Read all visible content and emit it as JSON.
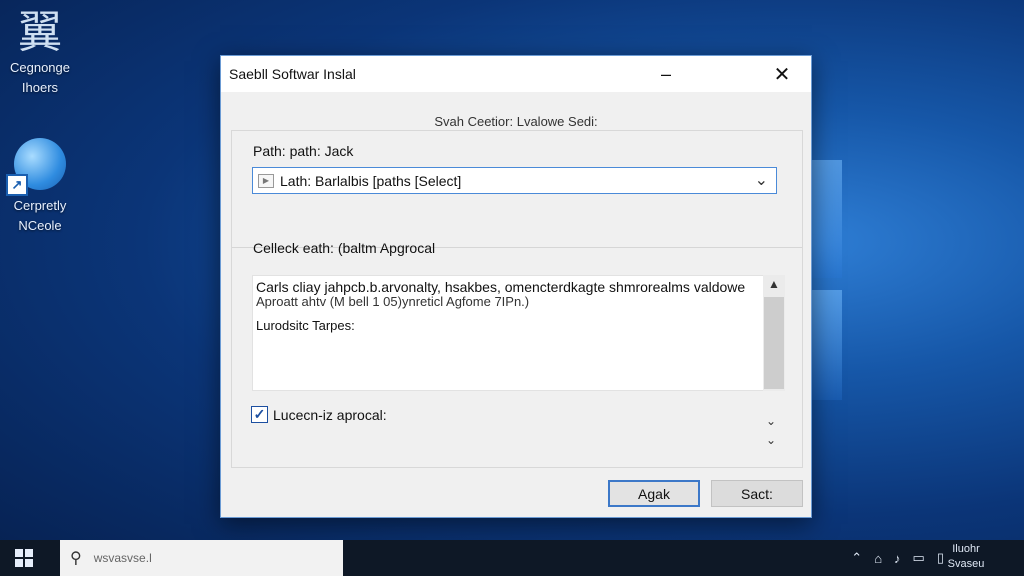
{
  "desktop": {
    "icons": [
      {
        "glyph": "翼",
        "label_line1": "Cegnonge",
        "label_line2": "Ihoers",
        "icon": "app-glyph-icon"
      },
      {
        "label_line1": "Cerpretly",
        "label_line2": "NCeole",
        "icon": "globe-installer-icon"
      }
    ]
  },
  "dialog": {
    "title": "Saebll Softwar Inslal",
    "minimize_glyph": "–",
    "close_glyph": "✕",
    "header": "Svah Ceetior: Lvalowe Sedi:",
    "path_label": "Path: path: Jack",
    "path_value": "Lath: Barlalbis [paths [Select]",
    "section_label": "Celleck eath: (baltm Apgrocal",
    "textbox_lines": [
      "Carls cliay jahpcb.b.arvonalty, hsakbes, omencterdkagte shmrorealms valdowe",
      "Aproatt ahtv (M bell 1 05)ynreticl Agfome 7IPn.)",
      "Lurodsitc Tarpes:"
    ],
    "checkbox_label": "Lucecn-iz aprocal:",
    "checkbox_checked": true,
    "ok_label": "Agak",
    "cancel_label": "Sact:"
  },
  "taskbar": {
    "search_placeholder": "wsvasvse.l",
    "tray_icons": [
      "chevron-up-icon",
      "network-icon",
      "volume-icon",
      "monitor-icon",
      "notification-icon"
    ],
    "clock_line1": "Iluohr",
    "clock_line2": "Svaseu"
  },
  "colors": {
    "accent": "#3c78c8",
    "desktop_bg": "#0b3578",
    "taskbar_bg": "#0e1826"
  }
}
